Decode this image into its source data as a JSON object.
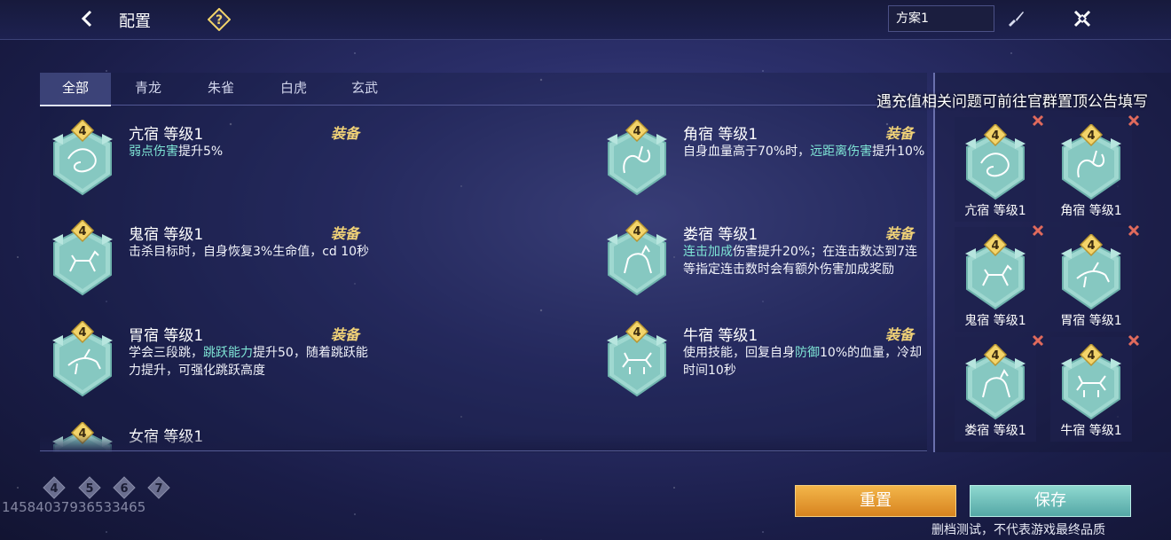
{
  "header": {
    "title": "配置",
    "plan_name": "方案1"
  },
  "tabs": [
    "全部",
    "青龙",
    "朱雀",
    "白虎",
    "玄武"
  ],
  "equip_label": "装备",
  "cards": [
    {
      "level_badge": "4",
      "title": "亢宿 等级1",
      "desc_parts": [
        {
          "t": "弱点伤害",
          "hl": true
        },
        {
          "t": "提升5%",
          "hl": false
        }
      ]
    },
    {
      "level_badge": "4",
      "title": "角宿 等级1",
      "desc_parts": [
        {
          "t": "自身血量高于70%时，",
          "hl": false
        },
        {
          "t": "远距离伤害",
          "hl": true
        },
        {
          "t": "提升10%",
          "hl": false
        }
      ]
    },
    {
      "level_badge": "4",
      "title": "鬼宿 等级1",
      "desc_parts": [
        {
          "t": "击杀目标时，自身恢复3%生命值，cd 10秒",
          "hl": false
        }
      ]
    },
    {
      "level_badge": "4",
      "title": "娄宿 等级1",
      "desc_parts": [
        {
          "t": "连击加成",
          "hl": true
        },
        {
          "t": "伤害提升20%；在连击数达到7连等指定连击数时会有额外伤害加成奖励",
          "hl": false
        }
      ]
    },
    {
      "level_badge": "4",
      "title": "胃宿 等级1",
      "desc_parts": [
        {
          "t": "学会三段跳，",
          "hl": false
        },
        {
          "t": "跳跃能力",
          "hl": true
        },
        {
          "t": "提升50，随着跳跃能力提升，可强化跳跃高度",
          "hl": false
        }
      ]
    },
    {
      "level_badge": "4",
      "title": "牛宿 等级1",
      "desc_parts": [
        {
          "t": "使用技能，回复自身",
          "hl": false
        },
        {
          "t": "防御",
          "hl": true
        },
        {
          "t": "10%的血量，冷却时间10秒",
          "hl": false
        }
      ]
    },
    {
      "level_badge": "4",
      "title": "女宿 等级1",
      "desc_parts": []
    }
  ],
  "sidebar": {
    "slots": [
      {
        "level_badge": "4",
        "label": "亢宿 等级1"
      },
      {
        "level_badge": "4",
        "label": "角宿 等级1"
      },
      {
        "level_badge": "4",
        "label": "鬼宿 等级1"
      },
      {
        "level_badge": "4",
        "label": "胃宿 等级1"
      },
      {
        "level_badge": "4",
        "label": "娄宿 等级1"
      },
      {
        "level_badge": "4",
        "label": "牛宿 等级1"
      }
    ]
  },
  "notice": "遇充值相关问题可前往官群置顶公告填写",
  "level_filters": [
    "4",
    "5",
    "6",
    "7"
  ],
  "uid": "14584037936533465",
  "buttons": {
    "reset": "重置",
    "save": "保存"
  },
  "disclaimer": "删档测试，不代表游戏最终品质",
  "colors": {
    "accent_teal": "#7fe6d6",
    "equip_gold": "#f1d277",
    "reset_orange": "#e29a30",
    "save_teal": "#6fc1bc",
    "remove_red": "#e06a5c"
  }
}
